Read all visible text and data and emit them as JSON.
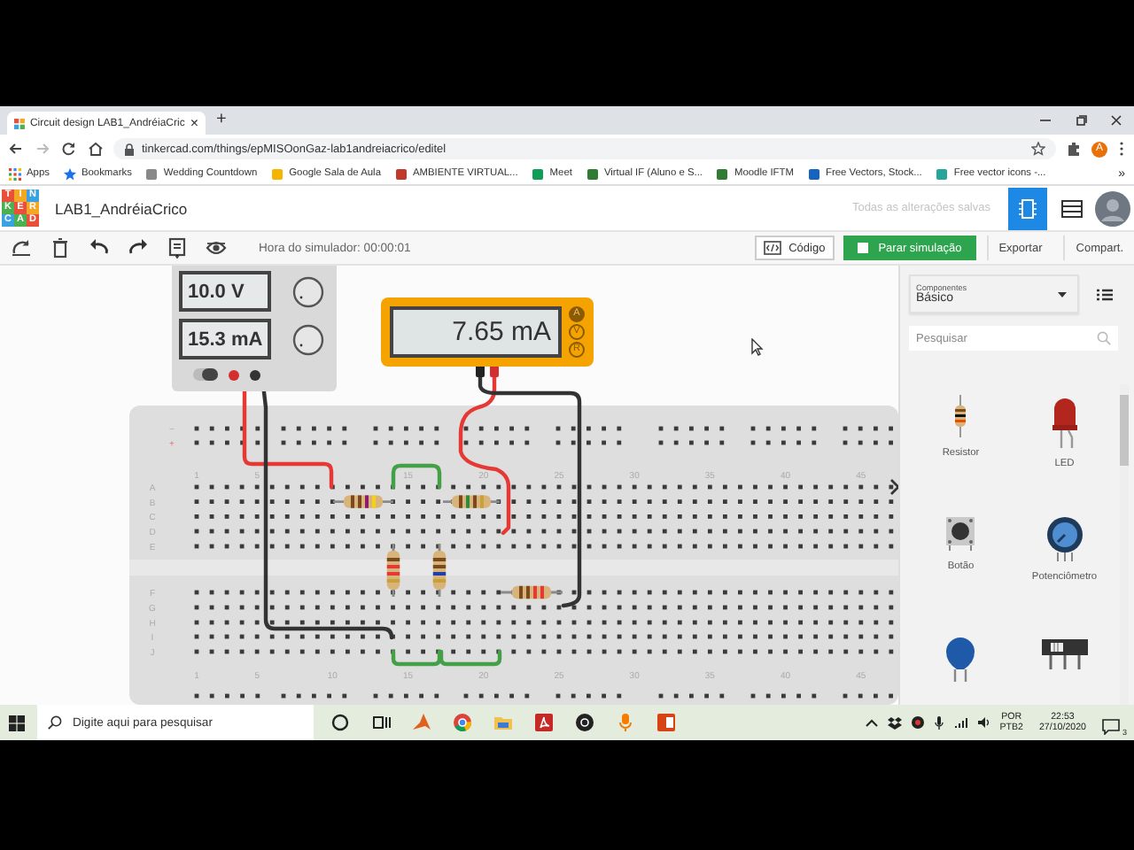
{
  "browser": {
    "tab": {
      "title": "Circuit design LAB1_AndréiaCric",
      "close": "×"
    },
    "new_tab": "+",
    "url": "tinkercad.com/things/epMISOonGaz-lab1andreiacrico/editel",
    "profile_initial": "A",
    "bookmarks": [
      {
        "label": "Apps"
      },
      {
        "label": "Bookmarks"
      },
      {
        "label": "Wedding Countdown"
      },
      {
        "label": "Google Sala de Aula"
      },
      {
        "label": "AMBIENTE VIRTUAL..."
      },
      {
        "label": "Meet"
      },
      {
        "label": "Virtual IF (Aluno e S..."
      },
      {
        "label": "Moodle IFTM"
      },
      {
        "label": "Free Vectors, Stock..."
      },
      {
        "label": "Free vector icons -..."
      }
    ],
    "more_bookmarks": "»"
  },
  "app": {
    "logo_letters": [
      "T",
      "I",
      "N",
      "K",
      "E",
      "R",
      "C",
      "A",
      "D"
    ],
    "title": "LAB1_AndréiaCrico",
    "save_status": "Todas as alterações salvas"
  },
  "toolbar": {
    "sim_time": "Hora do simulador: 00:00:01",
    "code_button": "Código",
    "sim_button": "Parar simulação",
    "export_button": "Exportar",
    "share_button": "Compart."
  },
  "power_supply": {
    "voltage": "10.0 V",
    "current": "15.3 mA"
  },
  "multimeter": {
    "reading": "7.65 mA",
    "modes": [
      {
        "label": "A",
        "selected": true
      },
      {
        "label": "V",
        "selected": false
      },
      {
        "label": "R",
        "selected": false
      }
    ]
  },
  "breadboard": {
    "rail_signs": [
      "−",
      "+"
    ],
    "row_letters": [
      "A",
      "B",
      "C",
      "D",
      "E",
      "F",
      "G",
      "H",
      "I",
      "J"
    ],
    "top_numbers": [
      "1",
      "5",
      "15",
      "20",
      "25",
      "30",
      "35",
      "40",
      "45"
    ],
    "bottom_numbers": [
      "1",
      "5",
      "10",
      "15",
      "20",
      "25",
      "30",
      "35",
      "40",
      "45"
    ]
  },
  "components_panel": {
    "category_label": "Componentes",
    "category": "Básico",
    "search_placeholder": "Pesquisar",
    "items": [
      {
        "kind": "resistor",
        "label": "Resistor"
      },
      {
        "kind": "led",
        "label": "LED"
      },
      {
        "kind": "pushbutton",
        "label": "Botão"
      },
      {
        "kind": "potentiometer",
        "label": "Potenciômetro"
      },
      {
        "kind": "capacitor"
      },
      {
        "kind": "slideswitch"
      }
    ]
  },
  "taskbar": {
    "search_placeholder": "Digite aqui para pesquisar",
    "language": "POR",
    "layout": "PTB2",
    "time": "22:53",
    "date": "27/10/2020",
    "notifications": "3"
  }
}
